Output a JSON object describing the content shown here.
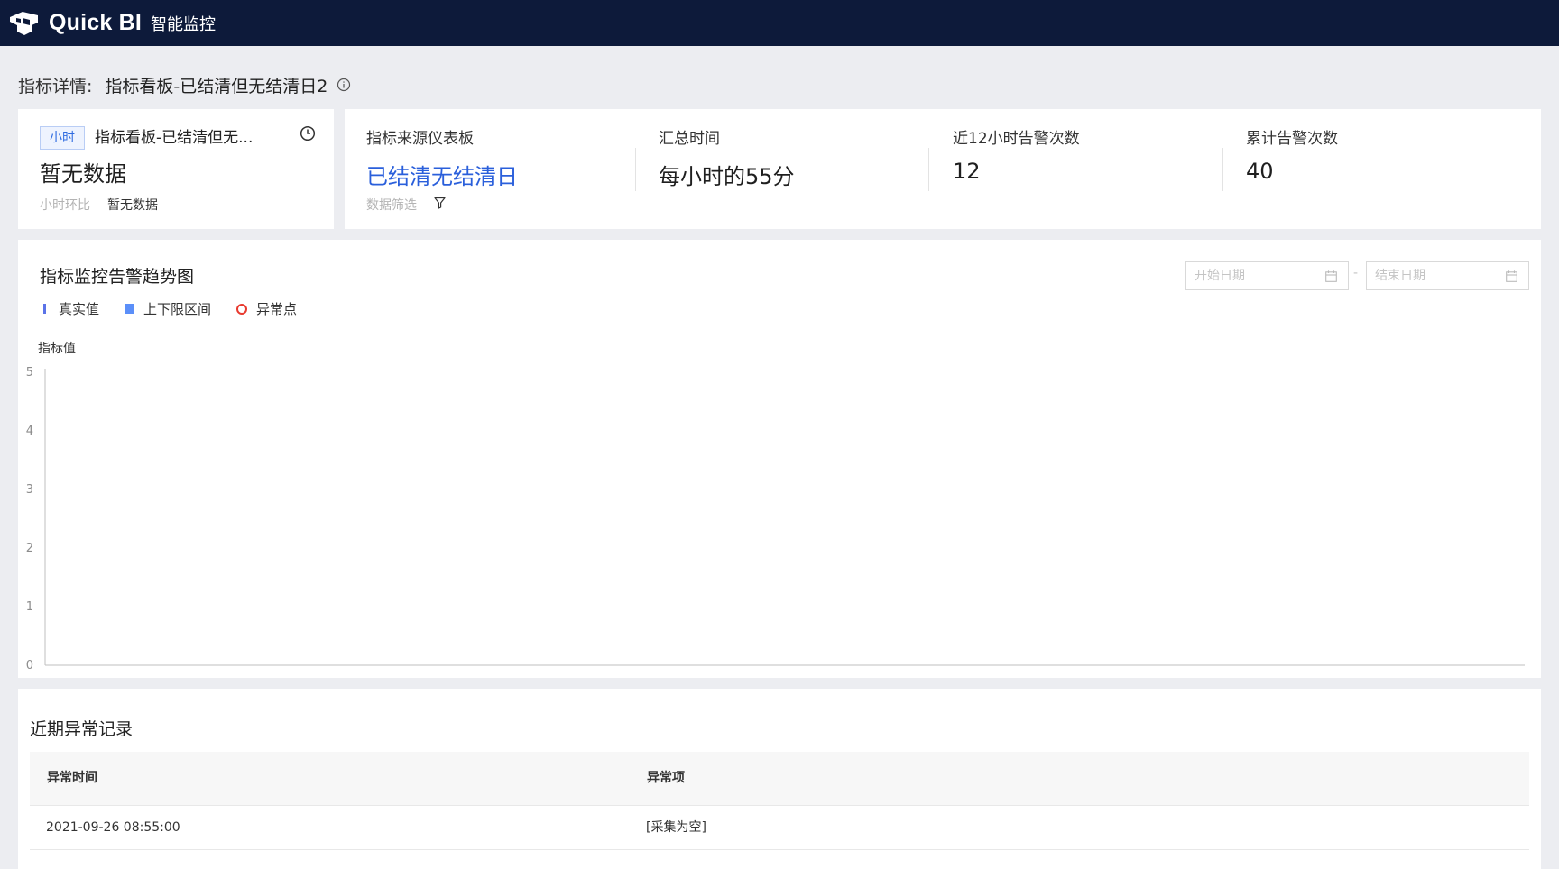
{
  "app": {
    "brand": "Quick BI",
    "module": "智能监控"
  },
  "page": {
    "title_label": "指标详情:",
    "title_value": "指标看板-已结清但无结清日2"
  },
  "summary_card": {
    "tag": "小时",
    "name": "指标看板-已结清但无...",
    "value": "暂无数据",
    "compare_label": "小时环比",
    "compare_value": "暂无数据"
  },
  "metrics": [
    {
      "label": "指标来源仪表板",
      "value": "已结清无结清日",
      "is_link": true
    },
    {
      "label": "汇总时间",
      "value": "每小时的55分"
    },
    {
      "label": "近12小时告警次数",
      "value": "12"
    },
    {
      "label": "累计告警次数",
      "value": "40"
    }
  ],
  "filter_label": "数据筛选",
  "chart": {
    "title": "指标监控告警趋势图",
    "start_placeholder": "开始日期",
    "end_placeholder": "结束日期",
    "date_separator": "-",
    "legend": [
      "真实值",
      "上下限区间",
      "异常点"
    ]
  },
  "chart_data": {
    "type": "line",
    "title": "指标监控告警趋势图",
    "ylabel": "指标值",
    "xlabel": "",
    "ylim": [
      0,
      5
    ],
    "yticks": [
      0,
      1,
      2,
      3,
      4,
      5
    ],
    "series": [
      {
        "name": "真实值",
        "values": []
      },
      {
        "name": "上下限区间",
        "values": []
      },
      {
        "name": "异常点",
        "values": []
      }
    ],
    "colors": {
      "真实值": "#5b73e8",
      "上下限区间": "#5b8ff9",
      "异常点": "#e83a2f"
    },
    "grid": false,
    "legend_position": "top-left"
  },
  "records": {
    "title": "近期异常记录",
    "columns": [
      "异常时间",
      "异常项"
    ],
    "rows": [
      [
        "2021-09-26 08:55:00",
        "[采集为空]"
      ]
    ]
  },
  "icons": [
    "quickbi-logo-icon",
    "info-icon",
    "clock-icon",
    "filter-icon",
    "calendar-icon"
  ]
}
